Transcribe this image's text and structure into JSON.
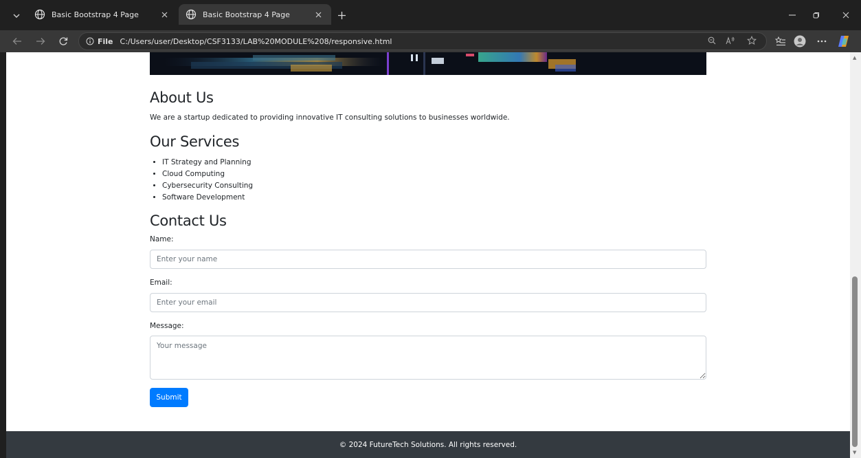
{
  "browser": {
    "tabs": [
      {
        "title": "Basic Bootstrap 4 Page",
        "active": false
      },
      {
        "title": "Basic Bootstrap 4 Page",
        "active": true
      }
    ],
    "address": {
      "scheme_label": "File",
      "url": "C:/Users/user/Desktop/CSF3133/LAB%20MODULE%208/responsive.html"
    },
    "colors": {
      "tabstrip": "#202020",
      "toolbar": "#383838",
      "accent_copilot": "#5b7cff"
    }
  },
  "page": {
    "about": {
      "heading": "About Us",
      "text": "We are a startup dedicated to providing innovative IT consulting solutions to businesses worldwide."
    },
    "services": {
      "heading": "Our Services",
      "items": [
        "IT Strategy and Planning",
        "Cloud Computing",
        "Cybersecurity Consulting",
        "Software Development"
      ]
    },
    "contact": {
      "heading": "Contact Us",
      "name_label": "Name:",
      "name_placeholder": "Enter your name",
      "email_label": "Email:",
      "email_placeholder": "Enter your email",
      "message_label": "Message:",
      "message_placeholder": "Your message",
      "submit_label": "Submit"
    },
    "footer": {
      "text": "© 2024 FutureTech Solutions. All rights reserved."
    },
    "colors": {
      "primary_button": "#007bff",
      "footer_bg": "#343a40",
      "text": "#212529"
    }
  }
}
